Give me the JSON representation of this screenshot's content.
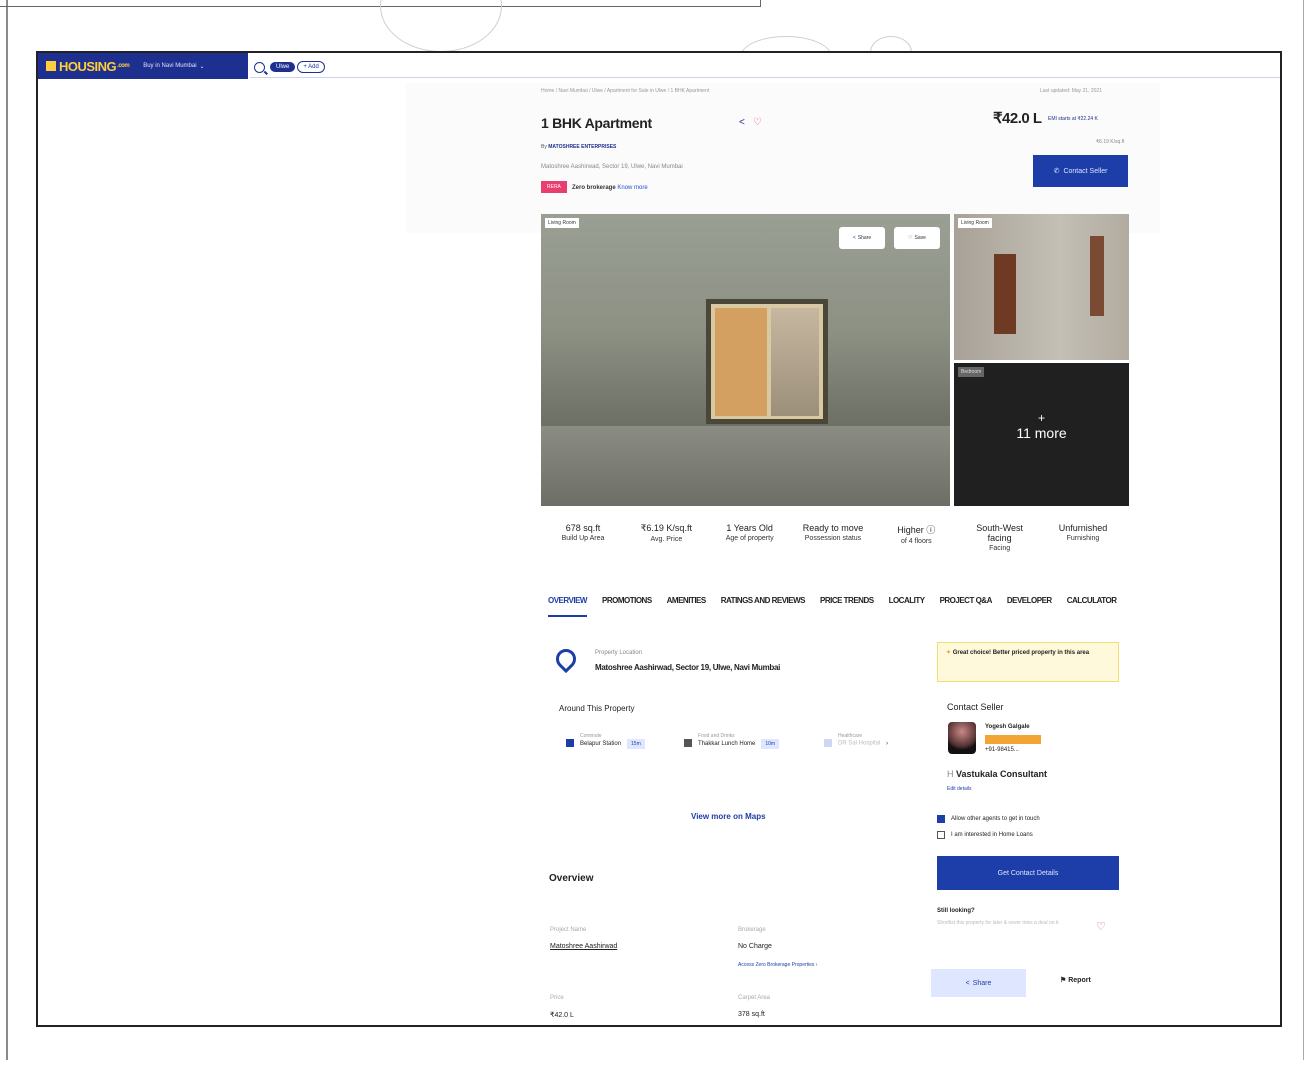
{
  "nav": {
    "logo": "HOUSING",
    "logo_suffix": ".com",
    "city": "Buy in Navi Mumbai"
  },
  "search": {
    "chip": "Ulwe",
    "add": "+ Add"
  },
  "breadcrumb": "Home / Navi Mumbai / Ulwe / Apartment for Sale in Ulwe / 1 BHK Apartment",
  "updated": "Last updated: May 21, 2021",
  "property": {
    "title": "1 BHK Apartment",
    "builder_prefix": "By",
    "builder": "MATOSHREE ENTERPRISES",
    "address": "Matoshree Aashirwad, Sector 19, Ulwe, Navi Mumbai",
    "rera": "RERA",
    "zero_brokerage": "Zero brokerage",
    "know_more": "Know more",
    "price": "₹42.0 L",
    "emi": "EMI starts at ₹22.24 K",
    "price_per_sqft": "₹6.19 K/sq.ft",
    "contact_seller": "Contact Seller"
  },
  "photos": {
    "main_label": "Living Room",
    "share": "Share",
    "save": "Save",
    "side_label": "Living Room",
    "more_label": "Bedroom",
    "more_plus": "+",
    "more_text": "11 more"
  },
  "stats": [
    {
      "value": "678 sq.ft",
      "label": "Build Up Area"
    },
    {
      "value": "₹6.19 K/sq.ft",
      "label": "Avg. Price"
    },
    {
      "value": "1 Years Old",
      "label": "Age of property"
    },
    {
      "value": "Ready to move",
      "label": "Possession status"
    },
    {
      "value": "Higher",
      "label": "of 4 floors"
    },
    {
      "value": "South-West facing",
      "label": "Facing"
    },
    {
      "value": "Unfurnished",
      "label": "Furnishing"
    }
  ],
  "tabs": [
    "OVERVIEW",
    "PROMOTIONS",
    "AMENITIES",
    "RATINGS AND REVIEWS",
    "PRICE TRENDS",
    "LOCALITY",
    "PROJECT Q&A",
    "DEVELOPER",
    "CALCULATOR"
  ],
  "location": {
    "label": "Property Location",
    "value": "Matoshree Aashirwad, Sector 19, Ulwe, Navi Mumbai"
  },
  "deal": "Great choice! Better priced property in this area",
  "around": {
    "title": "Around This Property",
    "items": [
      {
        "category": "Commute",
        "name": "Belapur Station",
        "time": "15m"
      },
      {
        "category": "Food and Drinks",
        "name": "Thakkar Lunch Home",
        "time": "10m"
      },
      {
        "category": "Healthcare",
        "name": "DR Sai Hospital",
        "time": ""
      }
    ],
    "maps_link": "View more on Maps"
  },
  "seller": {
    "heading": "Contact Seller",
    "agent_name": "Yogesh Galgale",
    "phone": "+91-98415...",
    "company": "Vastukala Consultant",
    "edit": "Edit details",
    "check_agents": "Allow other agents to get in touch",
    "check_loans": "I am interested in Home Loans",
    "get_details": "Get Contact Details",
    "still_looking": "Still looking?",
    "still_sub": "Shortlist this property for later & never miss a deal on it.",
    "share": "Share",
    "report": "Report"
  },
  "overview": {
    "heading": "Overview",
    "project_label": "Project Name",
    "project_value": "Matoshree Aashirwad",
    "brokerage_label": "Brokerage",
    "brokerage_value": "No Charge",
    "brokerage_link": "Access Zero Brokerage Properties ›",
    "price_label": "Price",
    "price_value": "₹42.0 L",
    "carpet_label": "Carpet Area",
    "carpet_value": "378 sq.ft"
  }
}
